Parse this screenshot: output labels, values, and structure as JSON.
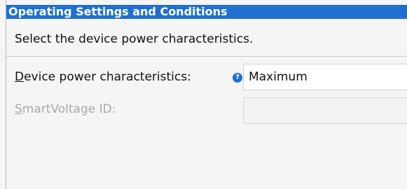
{
  "panel": {
    "title": "Operating Settings and Conditions",
    "description": "Select the device power characteristics."
  },
  "power_row": {
    "label_mnemonic": "D",
    "label_rest": "evice power characteristics:",
    "help_glyph": "?",
    "help_icon": "info-question-icon",
    "value": "Maximum"
  },
  "smartvoltage_row": {
    "label_mnemonic": "S",
    "label_rest": "martVoltage ID:",
    "value": ""
  },
  "colors": {
    "title_bar": "#1f6fd0",
    "disabled_text": "#a9a9a9"
  }
}
